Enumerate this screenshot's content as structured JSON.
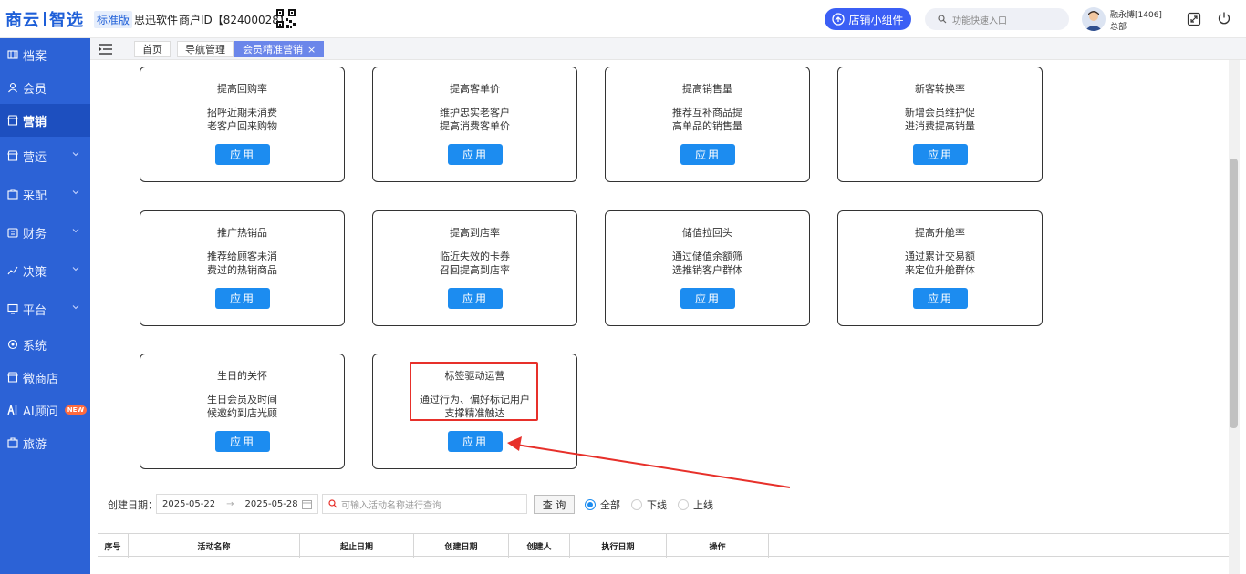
{
  "header": {
    "logo_left": "商云",
    "logo_right": "智选",
    "edition": "标准版",
    "company": "思迅软件",
    "merchant": "商户ID【82400028】",
    "shop_widget": "店铺小组件",
    "search_placeholder": "功能快速入口",
    "user_name": "融永博[1406]",
    "user_org": "总部"
  },
  "sidebar": {
    "items": [
      {
        "label": "档案"
      },
      {
        "label": "会员"
      },
      {
        "label": "营销"
      },
      {
        "label": "营运"
      },
      {
        "label": "采配"
      },
      {
        "label": "财务"
      },
      {
        "label": "决策"
      },
      {
        "label": "平台"
      },
      {
        "label": "系统"
      },
      {
        "label": "微商店"
      },
      {
        "label": "AI顾问"
      },
      {
        "label": "旅游"
      }
    ],
    "new_badge": "NEW"
  },
  "tabs": [
    {
      "label": "首页"
    },
    {
      "label": "导航管理"
    },
    {
      "label": "会员精准营销"
    }
  ],
  "cards": [
    {
      "title": "提高回购率",
      "line1": "招呼近期未消费",
      "line2": "老客户回来购物"
    },
    {
      "title": "提高客单价",
      "line1": "维护忠实老客户",
      "line2": "提高消费客单价"
    },
    {
      "title": "提高销售量",
      "line1": "推荐互补商品提",
      "line2": "高单品的销售量"
    },
    {
      "title": "新客转换率",
      "line1": "新增会员维护促",
      "line2": "进消费提高销量"
    },
    {
      "title": "推广热销品",
      "line1": "推荐给顾客未消",
      "line2": "费过的热销商品"
    },
    {
      "title": "提高到店率",
      "line1": "临近失效的卡券",
      "line2": "召回提高到店率"
    },
    {
      "title": "储值拉回头",
      "line1": "通过储值余额筛",
      "line2": "选推销客户群体"
    },
    {
      "title": "提高升舱率",
      "line1": "通过累计交易额",
      "line2": "来定位升舱群体"
    },
    {
      "title": "生日的关怀",
      "line1": "生日会员及时间",
      "line2": "候邀约到店光顾"
    },
    {
      "title": "标签驱动运营",
      "line1": "通过行为、偏好标记用户",
      "line2": "支撑精准触达"
    }
  ],
  "apply_label": "应用",
  "filter": {
    "label": "创建日期：",
    "start_date": "2025-05-22",
    "arrow": "→",
    "end_date": "2025-05-28",
    "search_placeholder": "可输入活动名称进行查询",
    "query_label": "查 询",
    "radio_all": "全部",
    "radio_offline": "下线",
    "radio_online": "上线"
  },
  "table": {
    "headers": [
      "序号",
      "活动名称",
      "起止日期",
      "创建日期",
      "创建人",
      "执行日期",
      "操作"
    ]
  },
  "colors": {
    "brand": "#2c62d6",
    "button": "#1c8cf0",
    "highlight": "#e7302a"
  }
}
